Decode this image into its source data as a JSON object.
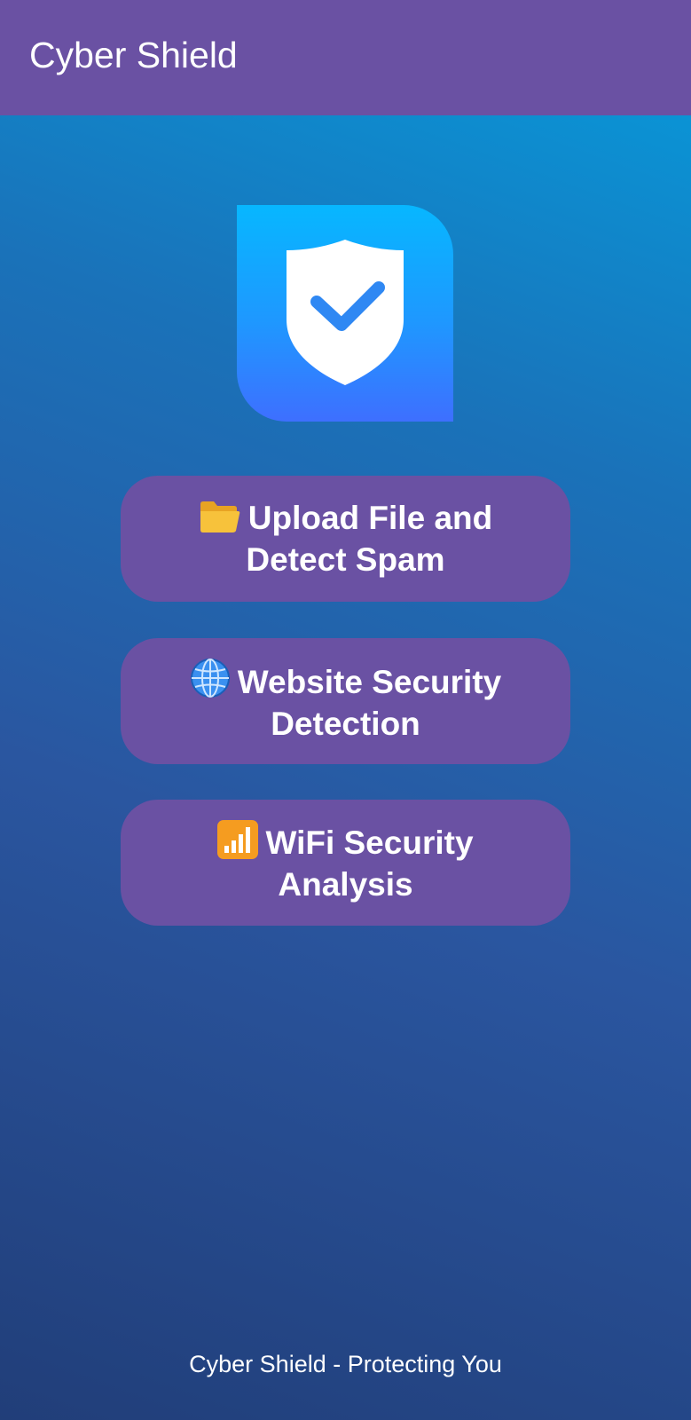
{
  "app_bar": {
    "title": "Cyber Shield",
    "color": "#6a51a3"
  },
  "logo": {
    "icon": "shield-check-icon"
  },
  "buttons": [
    {
      "icon": "folder-icon",
      "label_line1": "Upload File and",
      "label_line2": "Detect Spam"
    },
    {
      "icon": "globe-icon",
      "label_line1": "Website Security",
      "label_line2": "Detection"
    },
    {
      "icon": "signal-bars-icon",
      "label_line1": "WiFi Security",
      "label_line2": "Analysis"
    }
  ],
  "footer": {
    "text": "Cyber Shield - Protecting You"
  }
}
